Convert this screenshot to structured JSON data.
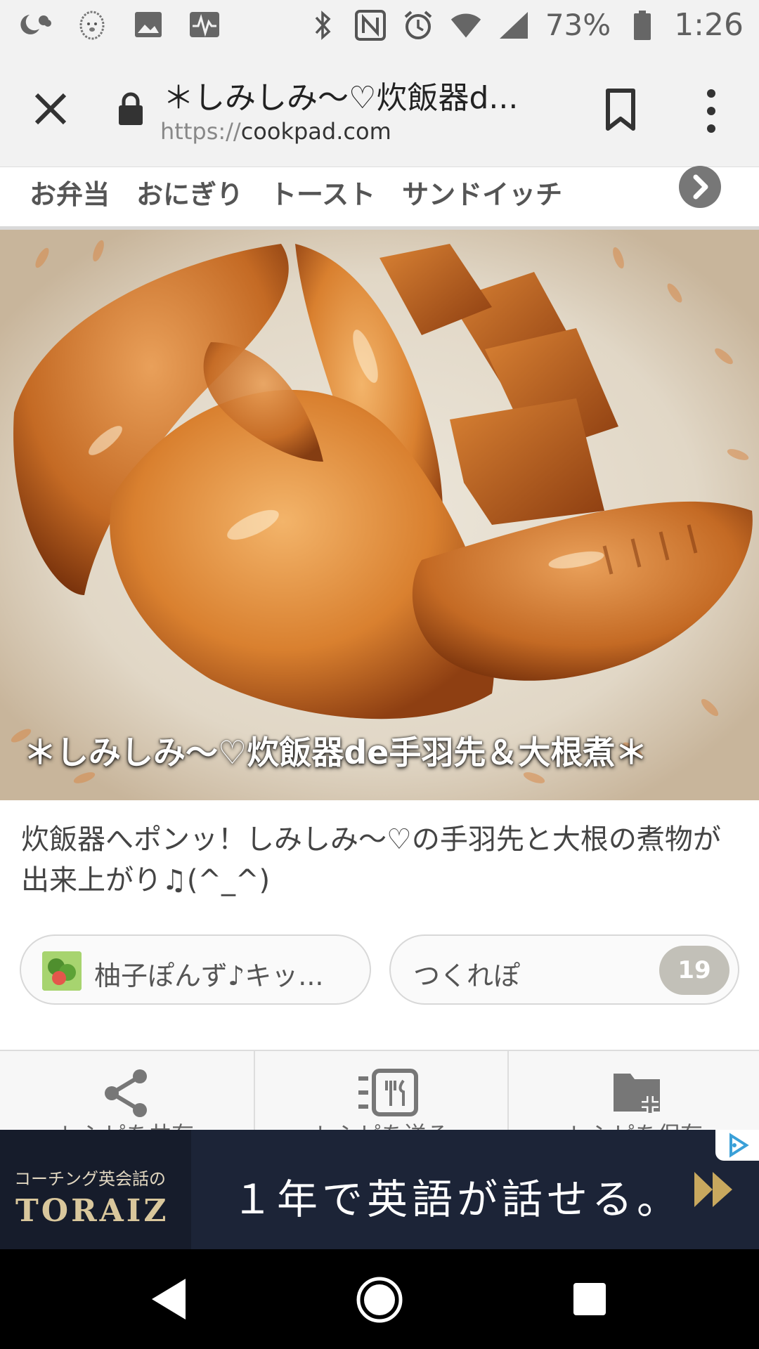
{
  "status_bar": {
    "battery_percent": "73%",
    "time": "1:26",
    "icons": [
      "moon-cloud-icon",
      "hedgehog-icon",
      "image-icon",
      "pulse-icon",
      "bluetooth-icon",
      "nfc-icon",
      "alarm-icon",
      "wifi-icon",
      "signal-icon",
      "battery-icon"
    ]
  },
  "browser": {
    "title": "＊しみしみ～♡炊飯器d...",
    "url_scheme": "https://",
    "url_host": "cookpad.com"
  },
  "categories": {
    "items": [
      "お弁当",
      "おにぎり",
      "トースト",
      "サンドイッチ"
    ]
  },
  "recipe": {
    "hero_title": "＊しみしみ～♡炊飯器de手羽先＆大根煮＊",
    "description": "炊飯器へポンッ！しみしみ～♡の手羽先と大根の煮物が出来上がり♫(^_^)",
    "author_name": "柚子ぽんず♪キッ...",
    "report_label": "つくれぽ",
    "report_count": "19"
  },
  "actions": {
    "items": [
      {
        "label": "レシピを共有",
        "icon": "share-icon"
      },
      {
        "label": "レシピを送る",
        "icon": "recipe-send-icon"
      },
      {
        "label": "レシピを保存",
        "icon": "folder-add-icon"
      }
    ]
  },
  "ad": {
    "sub": "コーチング英会話の",
    "brand": "TORAIZ",
    "copy": "１年で英語が話せる。"
  },
  "colors": {
    "status_bg": "#f2f2f2",
    "ad_bg": "#1c2437",
    "badge": "#c2c0b8"
  }
}
